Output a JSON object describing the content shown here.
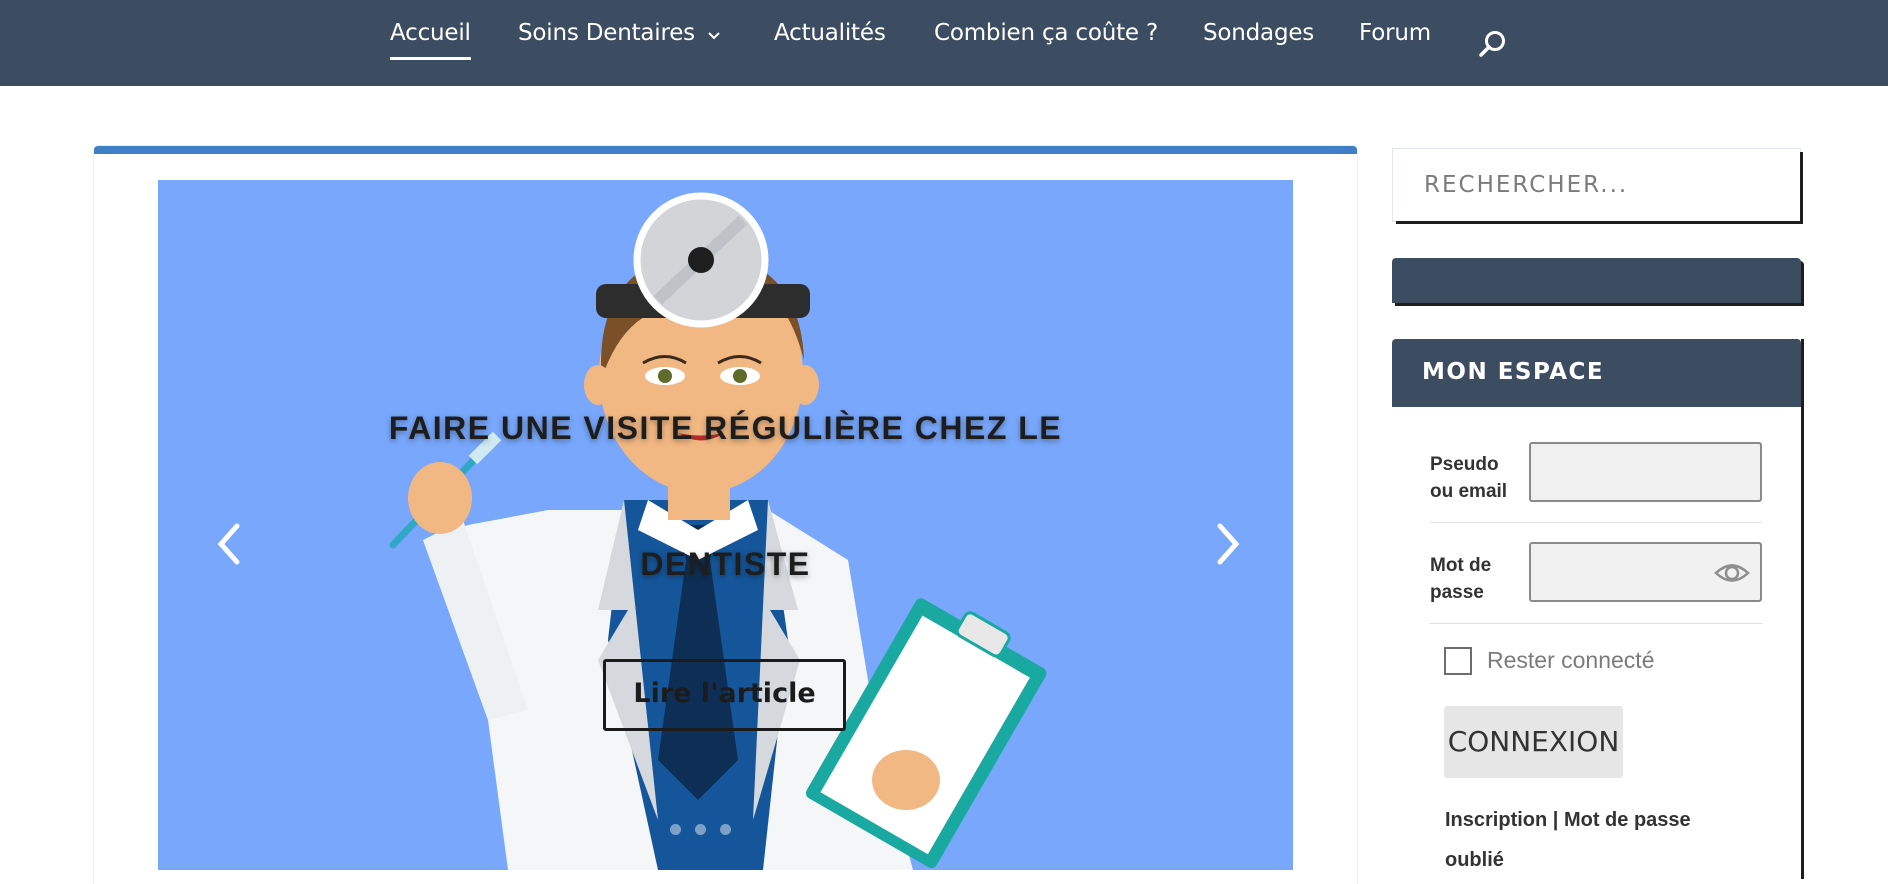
{
  "nav": {
    "items": [
      {
        "label": "Accueil",
        "active": true
      },
      {
        "label": "Soins Dentaires",
        "has_dropdown": true
      },
      {
        "label": "Actualités"
      },
      {
        "label": "Combien ça coûte ?"
      },
      {
        "label": "Sondages"
      },
      {
        "label": "Forum"
      }
    ],
    "search_icon": "search-icon",
    "background_color": "#3d4d61"
  },
  "slider": {
    "title_line1": "FAIRE UNE VISITE RÉGULIÈRE CHEZ LE",
    "title_line2": "DENTISTE",
    "button_label": "Lire l'article",
    "background_color": "#78a7fb",
    "dots_count": 3,
    "active_dot": 1
  },
  "card": {
    "accent_color": "#3f7fc8"
  },
  "sidebar": {
    "search": {
      "placeholder": "RECHERCHER..."
    },
    "mon_espace": {
      "title": "MON ESPACE",
      "username_label": "Pseudo ou email",
      "password_label": "Mot de passe",
      "remember_label": "Rester connecté",
      "login_button": "CONNEXION",
      "register_link": "Inscription",
      "link_separator": " | ",
      "forgot_link": "Mot de passe oublié"
    }
  }
}
